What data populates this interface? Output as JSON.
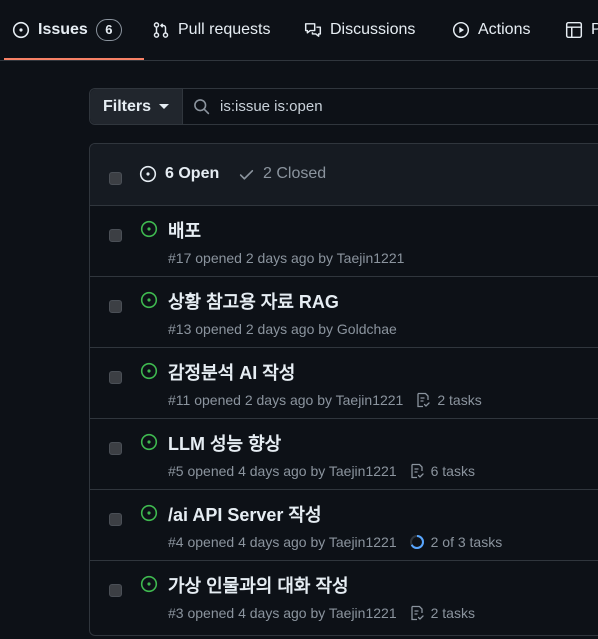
{
  "tabs": [
    {
      "label": "Issues",
      "count": "6",
      "icon": "issue-opened-icon",
      "active": true
    },
    {
      "label": "Pull requests",
      "icon": "git-pull-request-icon"
    },
    {
      "label": "Discussions",
      "icon": "comment-discussion-icon"
    },
    {
      "label": "Actions",
      "icon": "play-icon"
    },
    {
      "label": "P",
      "icon": "table-icon"
    }
  ],
  "filters": {
    "button_label": "Filters",
    "search_value": "is:issue is:open"
  },
  "list_header": {
    "open_label": "6 Open",
    "closed_label": "2 Closed"
  },
  "issues": [
    {
      "title": "배포",
      "meta": "#17 opened 2 days ago by Taejin1221",
      "tasks": ""
    },
    {
      "title": "상황 참고용 자료 RAG",
      "meta": "#13 opened 2 days ago by Goldchae",
      "tasks": ""
    },
    {
      "title": "감정분석 AI 작성",
      "meta": "#11 opened 2 days ago by Taejin1221",
      "tasks": "2 tasks",
      "tasks_icon": "checklist-icon"
    },
    {
      "title": "LLM 성능 향상",
      "meta": "#5 opened 4 days ago by Taejin1221",
      "tasks": "6 tasks",
      "tasks_icon": "checklist-icon"
    },
    {
      "title": "/ai API Server 작성",
      "meta": "#4 opened 4 days ago by Taejin1221",
      "tasks": "2 of 3 tasks",
      "tasks_icon": "progress-circle-icon",
      "tasks_progress": 0.67
    },
    {
      "title": "가상 인물과의 대화 작성",
      "meta": "#3 opened 4 days ago by Taejin1221",
      "tasks": "2 tasks",
      "tasks_icon": "checklist-icon"
    }
  ],
  "colors": {
    "background": "#0d1117",
    "border": "#30363d",
    "open_green": "#3fb950",
    "active_tab_underline": "#f78166",
    "muted_text": "#8b949e",
    "progress_blue": "#58a6ff"
  }
}
